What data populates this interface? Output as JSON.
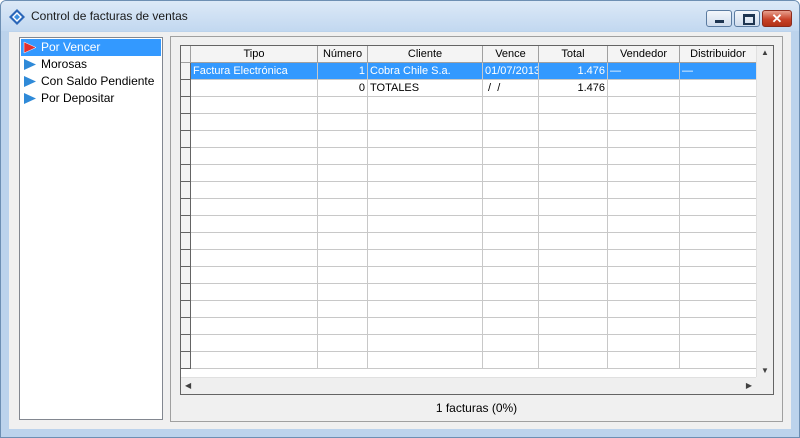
{
  "window": {
    "title": "Control de facturas de ventas"
  },
  "icons": {
    "app": "blue-diamond-icon",
    "minimize": "minimize-icon",
    "maximize": "maximize-icon",
    "close": "close-icon"
  },
  "colors": {
    "selection": "#3399ff",
    "selected_marker": "#e03030",
    "marker": "#2f8ad8"
  },
  "sidebar": {
    "items": [
      {
        "label": "Por Vencer",
        "selected": true
      },
      {
        "label": "Morosas",
        "selected": false
      },
      {
        "label": "Con Saldo Pendiente",
        "selected": false
      },
      {
        "label": "Por Depositar",
        "selected": false
      }
    ]
  },
  "grid": {
    "columns": [
      "Tipo",
      "Número",
      "Cliente",
      "Vence",
      "Total",
      "Vendedor",
      "Distribuidor"
    ],
    "rows": [
      [
        "Factura Electrónica",
        "1",
        "Cobra Chile S.a.",
        "01/07/2013",
        "1.476",
        "—",
        "—"
      ],
      [
        "",
        "0",
        "TOTALES",
        " /  /",
        "1.476",
        "",
        ""
      ]
    ]
  },
  "status": {
    "text": "1 facturas (0%)"
  }
}
